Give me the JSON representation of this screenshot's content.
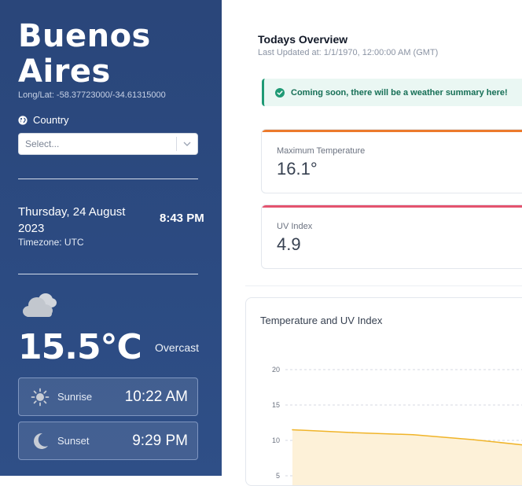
{
  "sidebar": {
    "city": "Buenos Aires",
    "lonlat": "Long/Lat: -58.37723000/-34.61315000",
    "country_label": "Country",
    "country_select_placeholder": "Select...",
    "date": "Thursday, 24 August 2023",
    "timezone": "Timezone: UTC",
    "time": "8:43 PM",
    "weather_icon": "cloud-icon",
    "temperature": "15.5°C",
    "condition": "Overcast",
    "sunrise": {
      "label": "Sunrise",
      "time": "10:22 AM",
      "icon": "sun-icon"
    },
    "sunset": {
      "label": "Sunset",
      "time": "9:29 PM",
      "icon": "moon-icon"
    }
  },
  "overview": {
    "title": "Todays Overview",
    "updated": "Last Updated at: 1/1/1970, 12:00:00 AM (GMT)",
    "alert": "Coming soon, there will be a weather summary here!",
    "cards": [
      {
        "label": "Maximum Temperature",
        "value": "16.1°",
        "accent": "#ec7a2c"
      },
      {
        "label": "UV Index",
        "value": "4.9",
        "accent": "#e4536e"
      }
    ]
  },
  "colors": {
    "sidebar_bg": "#2c4b82",
    "alert_green": "#1f9a75",
    "temp_line": "#f0b429",
    "temp_fill": "#fdf1d8"
  },
  "chart": {
    "title": "Temperature and UV Index",
    "chart_data": {
      "type": "area",
      "title": "Temperature and UV Index",
      "y_ticks": [
        "20",
        "15",
        "10",
        "5"
      ],
      "ylim": [
        5,
        20
      ],
      "grid": true,
      "series": [
        {
          "values": [
            11.5,
            11.1,
            10.8,
            10.1,
            9.2
          ]
        }
      ]
    }
  }
}
